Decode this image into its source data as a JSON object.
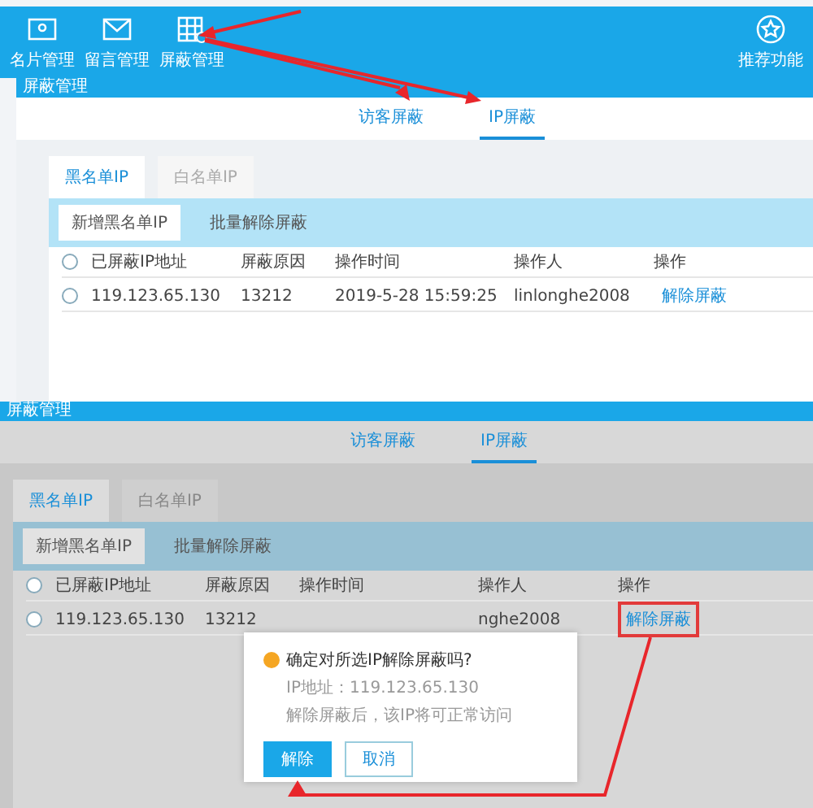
{
  "top_screen": {
    "nav": [
      {
        "label": "名片管理",
        "kind": "card"
      },
      {
        "label": "留言管理",
        "kind": "mail"
      },
      {
        "label": "屏蔽管理",
        "kind": "grid"
      }
    ],
    "nav_right": [
      {
        "label": "推荐功能",
        "kind": "star"
      }
    ],
    "window": {
      "title": "屏蔽管理",
      "tabs": [
        {
          "label": "访客屏蔽",
          "selected": false
        },
        {
          "label": "IP屏蔽",
          "selected": true
        }
      ],
      "subtabs": [
        {
          "label": "黑名单IP",
          "selected": true
        },
        {
          "label": "白名单IP",
          "selected": false
        }
      ],
      "buttons": [
        "新增黑名单IP",
        "批量解除屏蔽"
      ],
      "columns": [
        "已屏蔽IP地址",
        "屏蔽原因",
        "操作时间",
        "操作人",
        "操作"
      ],
      "all_checked": false,
      "rows": [
        {
          "checked": false,
          "ip": "119.123.65.130",
          "reason": "13212",
          "time": "2019-5-28 15:59:25",
          "operator": "linlonghe2008",
          "action": "解除屏蔽"
        }
      ]
    }
  },
  "bottom_screen": {
    "window": {
      "title": "屏蔽管理",
      "tabs": [
        {
          "label": "访客屏蔽",
          "selected": false
        },
        {
          "label": "IP屏蔽",
          "selected": true
        }
      ],
      "subtabs": [
        {
          "label": "黑名单IP",
          "selected": true
        },
        {
          "label": "白名单IP",
          "selected": false
        }
      ],
      "buttons": [
        "新增黑名单IP",
        "批量解除屏蔽"
      ],
      "columns": [
        "已屏蔽IP地址",
        "屏蔽原因",
        "操作时间",
        "操作人",
        "操作"
      ],
      "all_checked": false,
      "rows": [
        {
          "checked": false,
          "ip": "119.123.65.130",
          "reason": "13212",
          "operator": "nghe2008",
          "action": "解除屏蔽",
          "annotated": true
        }
      ]
    },
    "dialog": {
      "question": "确定对所选IP解除屏蔽吗?",
      "detail_1": "IP地址：119.123.65.130",
      "detail_2": "解除屏蔽后，该IP将可正常访问",
      "buttons": [
        {
          "label": "解除",
          "kind": "primary"
        },
        {
          "label": "取消",
          "kind": "secondary"
        }
      ]
    }
  }
}
